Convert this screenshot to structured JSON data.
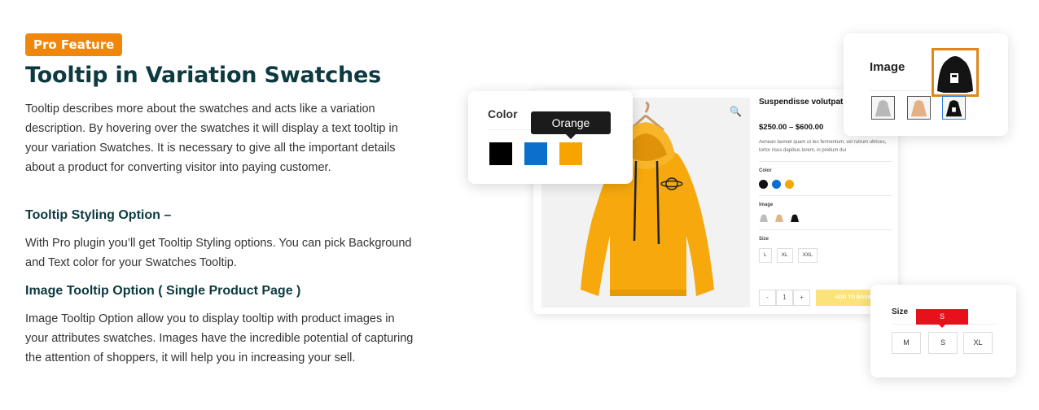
{
  "badge": "Pro Feature",
  "title": "Tooltip in Variation Swatches",
  "intro": "Tooltip describes more about the swatches and acts like a variation description. By hovering over the swatches it will display a text tooltip in your variation Swatches. It is necessary to give all the important details about a product for converting visitor into paying customer.",
  "section1": {
    "heading": "Tooltip Styling Option –",
    "body": "With Pro plugin you’ll get Tooltip Styling options. You can pick Background and Text color for your Swatches Tooltip."
  },
  "section2": {
    "heading": "Image Tooltip Option ( Single Product Page )",
    "body": "Image Tooltip Option allow you to display tooltip with product images in your attributes swatches. Images have the incredible potential of capturing the attention of shoppers, it will help you in increasing your sell."
  },
  "product": {
    "name": "Suspendisse volutpat",
    "price": "$250.00 – $600.00",
    "desc": "Aenean laoreet quam ut leo fermentum, vel rutrum ultrices, tortor risus dapibus lorem, in pretium dui",
    "color_label": "Color",
    "image_label": "Image",
    "size_label": "Size",
    "sizes": [
      "L",
      "XL",
      "XXL"
    ],
    "qty_minus": "-",
    "qty_value": "1",
    "qty_plus": "+",
    "add_to_basket": "ADD TO BASKET",
    "colors": [
      "#111111",
      "#0a6fcf",
      "#f5a700"
    ]
  },
  "color_popup": {
    "label": "Color",
    "tooltip": "Orange",
    "swatches": [
      "#000000",
      "#0b6fcb",
      "#f8a400"
    ]
  },
  "image_popup": {
    "label": "Image"
  },
  "size_popup": {
    "label": "Size",
    "tooltip": "S",
    "sizes": [
      "M",
      "S",
      "XL"
    ]
  },
  "colors": {
    "accent": "#f0870b",
    "heading": "#0c3a40",
    "hoodie": "#f6a80c",
    "size_tooltip": "#e8111b"
  }
}
